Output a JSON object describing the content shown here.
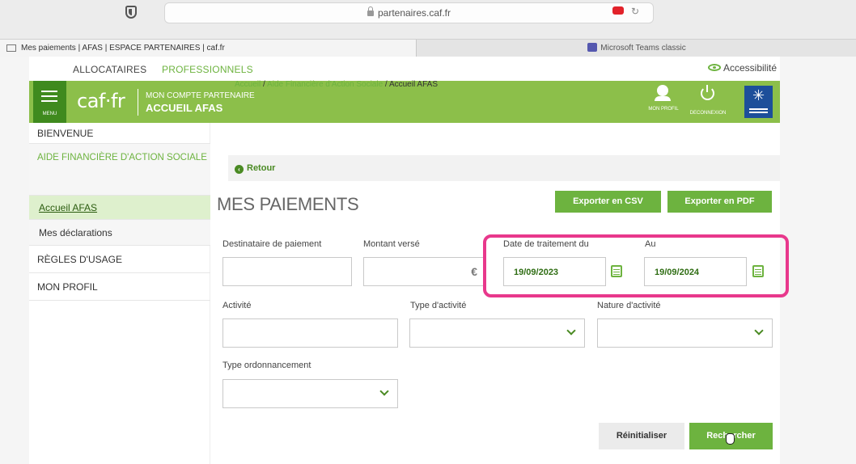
{
  "browser": {
    "url": "partenaires.caf.fr",
    "tabs": [
      {
        "label": "Mes paiements | AFAS | ESPACE PARTENAIRES | caf.fr"
      },
      {
        "label": "Microsoft Teams classic"
      }
    ]
  },
  "topnav": {
    "allocataires": "ALLOCATAIRES",
    "professionnels": "PROFESSIONNELS",
    "accessibilite": "Accessibilité"
  },
  "header": {
    "menu_label": "MENU",
    "logo": "caf·fr",
    "line1": "MON COMPTE PARTENAIRE",
    "line2": "ACCUEIL AFAS",
    "profil_label": "MON PROFIL",
    "deconnexion_label": "DECONNEXION"
  },
  "sidebar": {
    "items": [
      {
        "label": "BIENVENUE"
      },
      {
        "label": "AIDE FINANCIÈRE D'ACTION SOCIALE"
      },
      {
        "label": "Accueil AFAS"
      },
      {
        "label": "Mes déclarations"
      },
      {
        "label": "RÈGLES D'USAGE"
      },
      {
        "label": "MON PROFIL"
      }
    ]
  },
  "breadcrumb": {
    "home": "Accueil",
    "sep": " / ",
    "aide": "Aide Financière d'Action Sociale",
    "current": "Accueil AFAS"
  },
  "retour": "Retour",
  "page_title": "MES PAIEMENTS",
  "export": {
    "csv": "Exporter en CSV",
    "pdf": "Exporter en PDF"
  },
  "form": {
    "destinataire_label": "Destinataire de paiement",
    "montant_label": "Montant versé",
    "date_du_label": "Date de traitement du",
    "date_du_value": "19/09/2023",
    "date_au_label": "Au",
    "date_au_value": "19/09/2024",
    "activite_label": "Activité",
    "type_activite_label": "Type d'activité",
    "nature_activite_label": "Nature d'activité",
    "type_ordo_label": "Type ordonnancement",
    "euro_symbol": "€"
  },
  "buttons": {
    "reset": "Réinitialiser",
    "search": "Rechercher"
  },
  "colors": {
    "brand_green": "#8cbf4a",
    "dark_green": "#3f8a1e",
    "button_green": "#6db33f",
    "highlight_pink": "#e8388c"
  }
}
